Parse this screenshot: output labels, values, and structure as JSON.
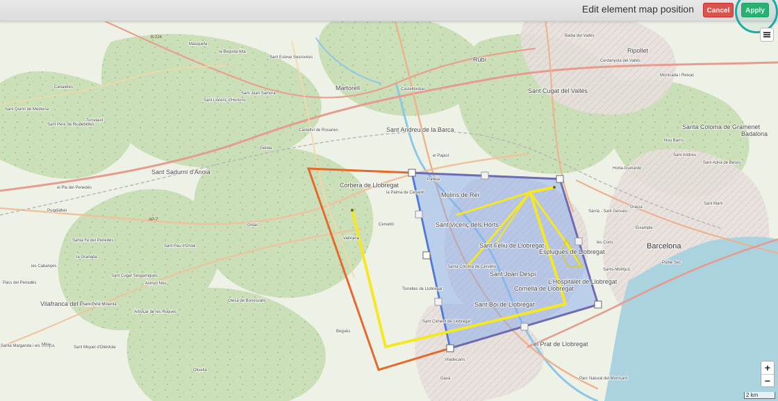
{
  "toolbar": {
    "title": "Edit element map position",
    "cancel_label": "Cancel",
    "apply_label": "Apply"
  },
  "map": {
    "scale_label": "2 km",
    "zoom_in_label": "+",
    "zoom_out_label": "−",
    "labels": [
      "Masquefa",
      "B-224",
      "la Beguda Alta",
      "Sant Esteve Sesrovires",
      "Rubí",
      "Badia del Vallès",
      "Ripollet",
      "Cerdanyola del Vallès",
      "Montcada i Reixac",
      "Canaletes",
      "Sant Quintí de Mediona",
      "Sant Llorenç d'Hortons",
      "Sant Joan Samora",
      "Martorell",
      "Castellbisbal",
      "Sant Cugat del Vallès",
      "Sant Pere de Riudebitlles",
      "Torrelavit",
      "Castellví de Rosanes",
      "Gelida",
      "Sant Andreu de la Barca",
      "el Papiol",
      "Santa Coloma de Gramenet",
      "Badalona",
      "Nou Barris",
      "Sant Andreu",
      "Horta-Guinardó",
      "Sant Adrià de Besòs",
      "Sant Sadurní d'Anoia",
      "Corbera de Llobregat",
      "la Palma de Cervelló",
      "Pallejà",
      "Molins de Rei",
      "el Pla del Penedès",
      "Puigdàlber",
      "AP-7",
      "Ordal",
      "Cervelló",
      "Vallirana",
      "Sant Vicenç dels Horts",
      "Sant Feliu de Llobregat",
      "Esplugues de Llobregat",
      "Sarrià - Sant Gervasi",
      "Gràcia",
      "Sant Martí",
      "Eixample",
      "Santa Fe del Penedès",
      "Sant Pau d'Ordal",
      "la Granada",
      "les Corts",
      "Barcelona",
      "Poble Sec",
      "les Cabanyes",
      "Santa Coloma de Cervelló",
      "Sant Joan Despí",
      "Sants-Montjuïc",
      "Pacs del Penedès",
      "Sant Cugat Sesgarrigues",
      "Avinyó Nou",
      "Torrelles de Llobregat",
      "L'Hospitalet de Llobregat",
      "Cornellà de Llobregat",
      "Vilafranca del Penedès",
      "Sant Pere Molanta",
      "Olesa de Bonesvalls",
      "Sant Boi de Llobregat",
      "Sant Climent de Llobregat",
      "Begues",
      "Arboçar de les Roques",
      "Santa Margarida i els Monjos",
      "Moja",
      "Sant Miquel d'Olèrdola",
      "Olivella",
      "el Prat de Llobregat",
      "Viladecans",
      "Gavà",
      "Parc Natural del Montsant"
    ]
  },
  "colors": {
    "orange_outline": "#e8682a",
    "blue_outline": "#3c7ff0",
    "purple_outline": "#6d6bb2",
    "selection_fill": "#7ea6ef",
    "yellow_outline": "#f5e823",
    "cancel": "#d9534f",
    "apply": "#2ab06d",
    "highlight_ring": "#1ea9a0"
  },
  "icons": [
    "layers-icon",
    "zoom-in-icon",
    "zoom-out-icon",
    "resize-handle-icon"
  ]
}
